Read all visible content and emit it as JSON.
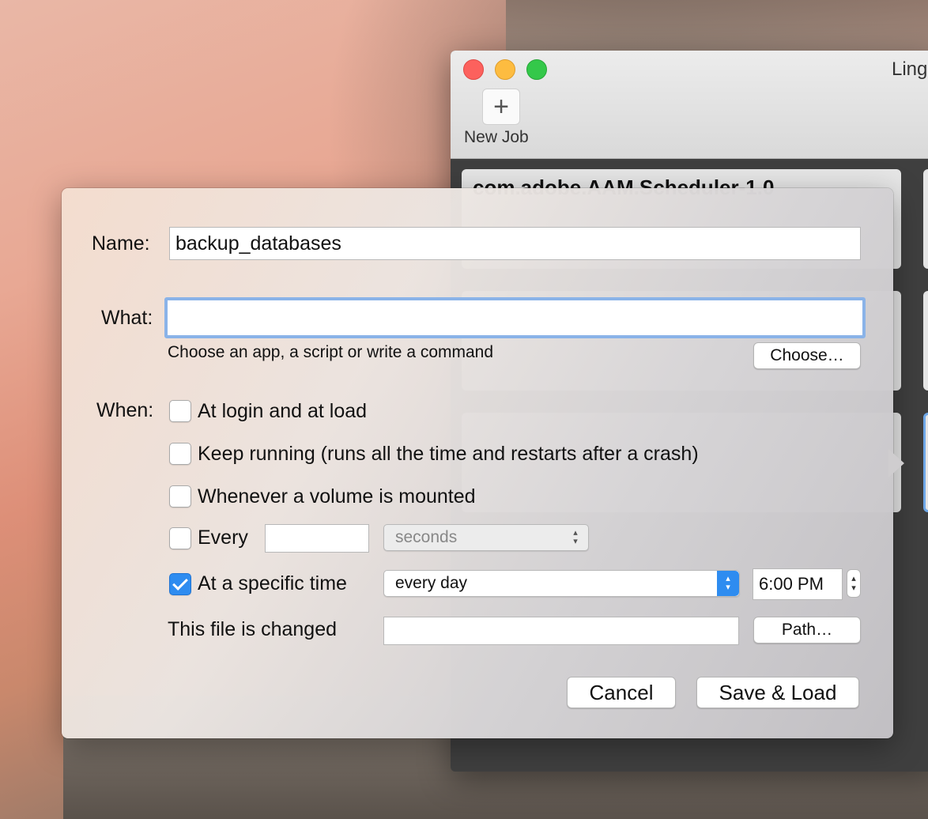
{
  "background_window": {
    "title": "Ling",
    "toolbar": {
      "new_job_label": "New Job",
      "new_job_icon": "plus-icon"
    },
    "job_cards": [
      {
        "title": "com.adobe.AAM.Scheduler-1.0"
      }
    ]
  },
  "sheet": {
    "name_label": "Name:",
    "name_value": "backup_databases",
    "what_label": "What:",
    "what_value": "",
    "what_hint": "Choose an app, a script or write a command",
    "choose_button": "Choose…",
    "when_label": "When:",
    "options": {
      "at_login": {
        "label": "At login and at load",
        "checked": false
      },
      "keep_running": {
        "label": "Keep running (runs all the time and restarts after a crash)",
        "checked": false
      },
      "volume_mounted": {
        "label": "Whenever a volume is mounted",
        "checked": false
      },
      "every": {
        "label": "Every",
        "checked": false,
        "value": "",
        "unit": "seconds"
      },
      "specific_time": {
        "label": "At a specific time",
        "checked": true,
        "frequency": "every day",
        "time": "6:00 PM"
      },
      "file_changed": {
        "label": "This file is changed",
        "path_value": "",
        "path_button": "Path…"
      }
    },
    "cancel_button": "Cancel",
    "save_button": "Save & Load"
  },
  "colors": {
    "accent": "#2e8cf0",
    "focus_ring": "#8ab3e8"
  }
}
